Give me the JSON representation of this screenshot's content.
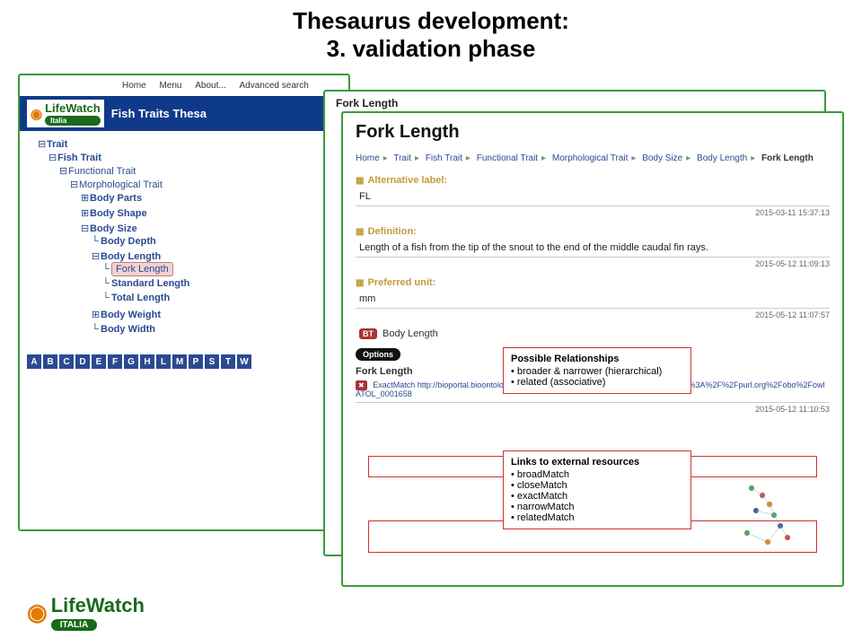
{
  "title_line1": "Thesaurus development:",
  "title_line2": "3. validation phase",
  "nav": {
    "links": [
      "Home",
      "Menu",
      "About...",
      "Advanced search"
    ],
    "logo_text": "LifeWatch",
    "logo_tag": "Italia",
    "app_title": "Fish Traits Thesa",
    "tree": {
      "root": "Trait",
      "l1": "Fish Trait",
      "l2": "Functional Trait",
      "l3": "Morphological Trait",
      "l4a": "Body Parts",
      "l4b": "Body Shape",
      "l4c": "Body Size",
      "l5a": "Body Depth",
      "l5b": "Body Length",
      "l6a": "Fork Length",
      "l6b": "Standard Length",
      "l6c": "Total Length",
      "l5c": "Body Weight",
      "l5d": "Body Width"
    },
    "alpha": [
      "A",
      "B",
      "C",
      "D",
      "E",
      "F",
      "G",
      "H",
      "L",
      "M",
      "P",
      "S",
      "T",
      "W"
    ]
  },
  "back_panel_header": "Fork Length",
  "detail": {
    "heading": "Fork Length",
    "crumbs": [
      "Home",
      "Trait",
      "Fish Trait",
      "Functional Trait",
      "Morphological Trait",
      "Body Size",
      "Body Length",
      "Fork Length"
    ],
    "alt_label_hdr": "Alternative label:",
    "alt_label_val": "FL",
    "alt_label_ts": "2015-03-11 15:37:13",
    "def_hdr": "Definition:",
    "def_val": "Length of a fish from the tip of the snout to the end of the middle caudal fin rays.",
    "def_ts": "2015-05-12 11:09:13",
    "unit_hdr": "Preferred unit:",
    "unit_val": "mm",
    "unit_ts": "2015-05-12 11:07:57",
    "bt_badge": "BT",
    "bt_val": "Body Length",
    "options": "Options",
    "opt_title": "Fork Length",
    "exact_badge": "✖",
    "exact_label": "ExactMatch",
    "exact_url": "http://bioportal.bioontology.org/ontologies/ATOL/?p=classes&conceptid=http%3A%2F%2Fpurl.org%2Fobo%2FowlATOL_0001658",
    "exact_ts": "2015-05-12 11:10:53"
  },
  "callout1": {
    "hdr": "Possible Relationships",
    "items": [
      "broader & narrower (hierarchical)",
      "related (associative)"
    ]
  },
  "callout2": {
    "hdr": "Links to external resources",
    "items": [
      "broadMatch",
      "closeMatch",
      "exactMatch",
      "narrowMatch",
      "relatedMatch"
    ]
  },
  "footer_logo": "LifeWatch",
  "footer_tag": "ITALIA"
}
